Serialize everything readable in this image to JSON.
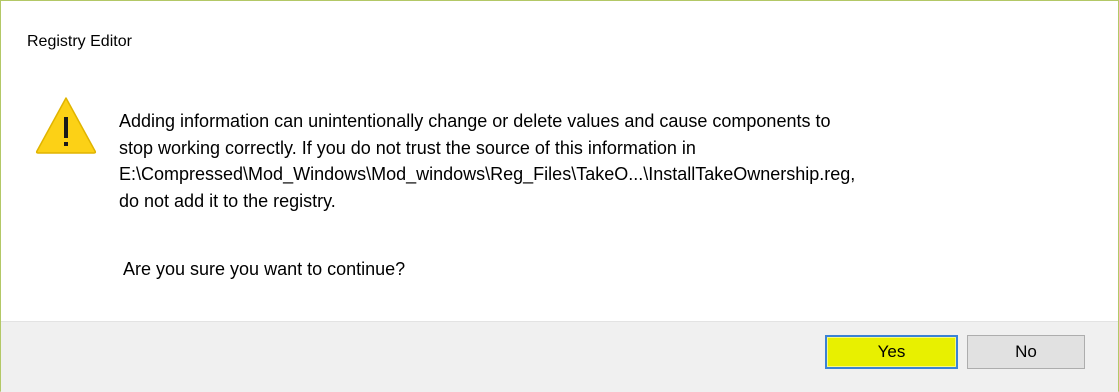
{
  "window": {
    "title": "Registry Editor"
  },
  "dialog": {
    "icon": "warning-icon",
    "icon_color": "#fcd116",
    "message_lines": [
      "Adding information can unintentionally change or delete values and cause components to",
      "stop working correctly. If you do not trust the source of this information in",
      "E:\\Compressed\\Mod_Windows\\Mod_windows\\Reg_Files\\TakeO...\\InstallTakeOwnership.reg,",
      "do not add it to the registry."
    ],
    "question": "Are you sure you want to continue?"
  },
  "buttons": {
    "yes_label": "Yes",
    "no_label": "No",
    "yes_highlight_color": "#e8f000",
    "focus_border_color": "#3b82d6"
  }
}
